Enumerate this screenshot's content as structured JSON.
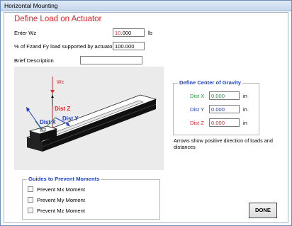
{
  "window": {
    "title": "Horizontal Mounting"
  },
  "heading": "Define Load on Actuator",
  "load": {
    "wz_label": "Enter Wz",
    "wz_value_red": "10",
    "wz_value_rest": ".000",
    "wz_unit": "lb",
    "pct_label": "% of Fzand Fy load supported by actuator",
    "pct_value": "100.000",
    "desc_label": "Brief Description",
    "desc_value": ""
  },
  "illustration": {
    "wz_label": "Wz",
    "dist_z": "Dist Z",
    "dist_x": "Dist X",
    "dist_y": "Dist Y"
  },
  "cog": {
    "title": "Define Center of Gravity",
    "rows": [
      {
        "label": "Dist X",
        "value": "0.000",
        "unit": "in"
      },
      {
        "label": "Dist Y",
        "value": "0.000",
        "unit": "in"
      },
      {
        "label": "Dist Z",
        "value": "0.000",
        "unit": "in"
      }
    ]
  },
  "note": "Arrows show positive direction of loads and distances",
  "guides": {
    "title": "Guides to Prevent Moments",
    "options": [
      {
        "label": "Prevent Mx Moment",
        "checked": false
      },
      {
        "label": "Prevent My Moment",
        "checked": false
      },
      {
        "label": "Prevent Mz Moment",
        "checked": false
      }
    ]
  },
  "done_label": "DONE",
  "colors": {
    "red": "#e0262c",
    "green": "#1f9e3c",
    "blue": "#1d3fcc"
  }
}
